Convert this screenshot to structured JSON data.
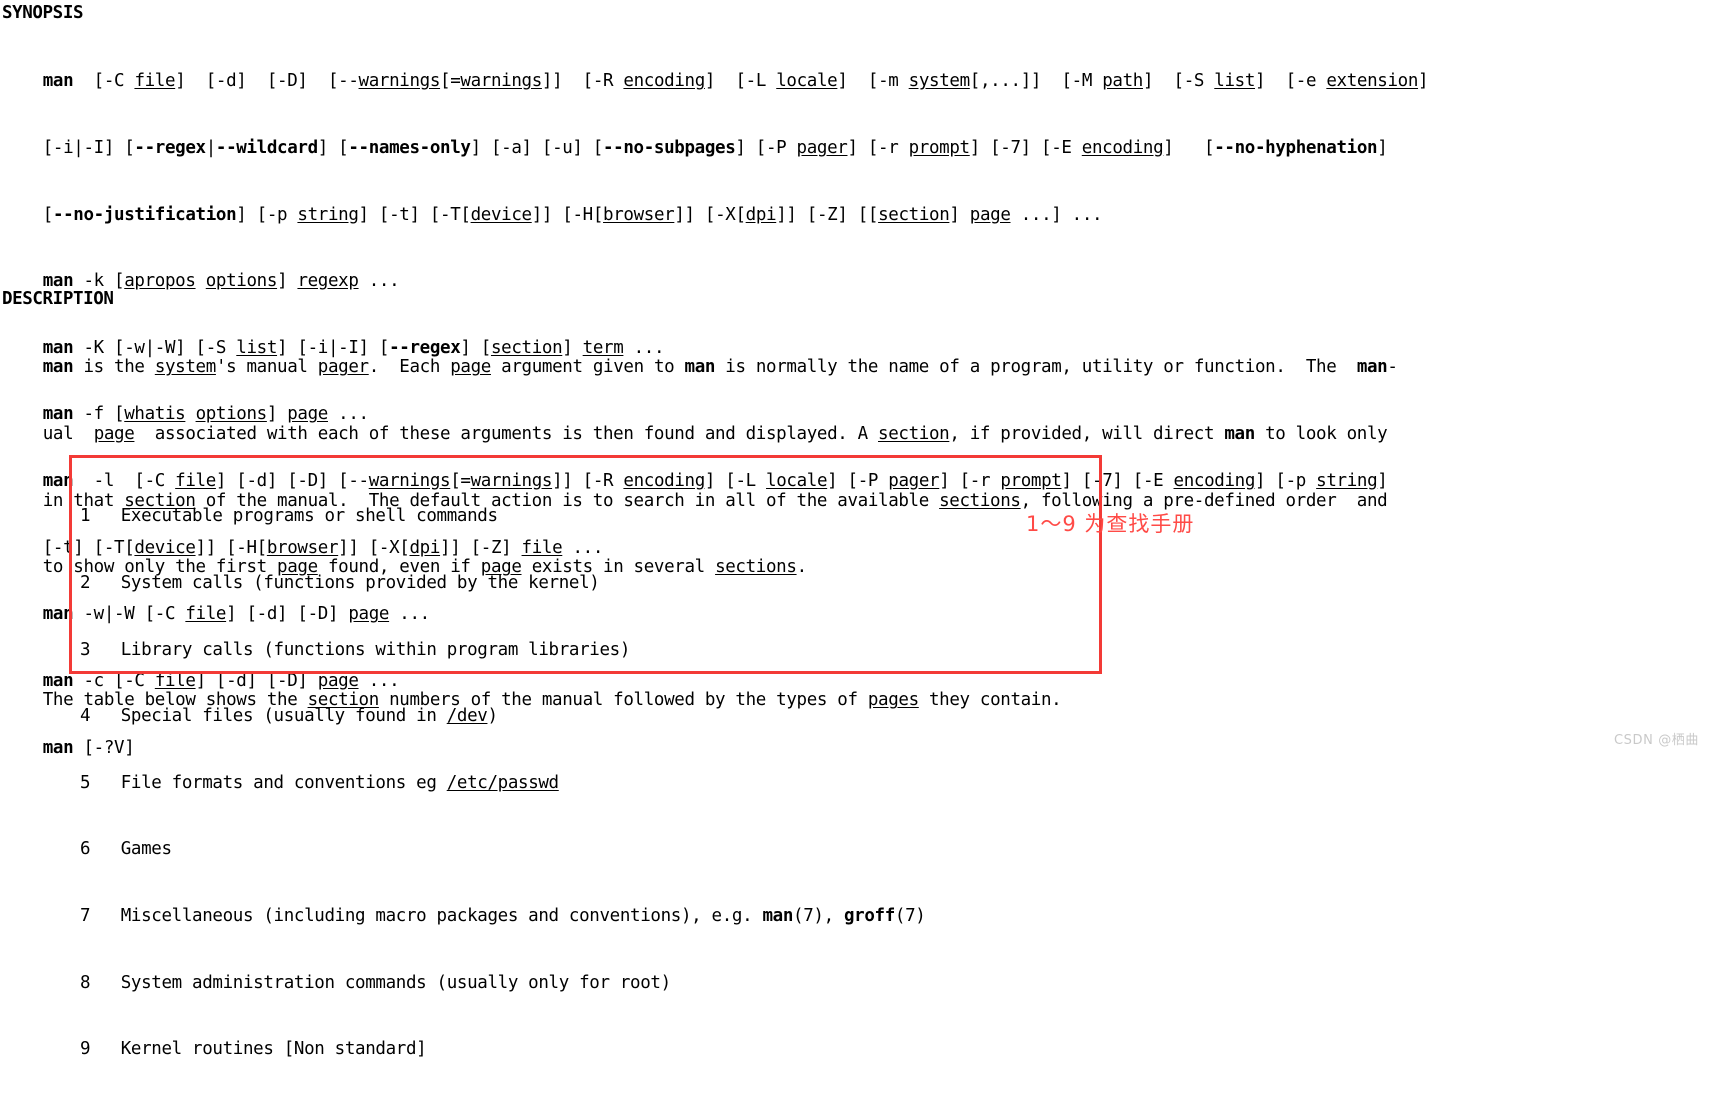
{
  "document": {
    "type": "man-page",
    "program": "man",
    "watermark": "CSDN @栖曲"
  },
  "synopsis": {
    "heading": "SYNOPSIS",
    "lines": [
      "    man  [-C file]  [-d]  [-D]  [--warnings[=warnings]]  [-R encoding]  [-L locale]  [-m system[,...]]  [-M path]  [-S list]  [-e extension]",
      "    [-i|-I] [--regex|--wildcard] [--names-only] [-a] [-u] [--no-subpages] [-P pager] [-r prompt] [-7] [-E encoding]   [--no-hyphenation]",
      "    [--no-justification] [-p string] [-t] [-T[device]] [-H[browser]] [-X[dpi]] [-Z] [[section] page ...] ...",
      "    man -k [apropos options] regexp ...",
      "    man -K [-w|-W] [-S list] [-i|-I] [--regex] [section] term ...",
      "    man -f [whatis options] page ...",
      "    man  -l  [-C file] [-d] [-D] [--warnings[=warnings]] [-R encoding] [-L locale] [-P pager] [-r prompt] [-7] [-E encoding] [-p string]",
      "    [-t] [-T[device]] [-H[browser]] [-X[dpi]] [-Z] file ...",
      "    man -w|-W [-C file] [-d] [-D] page ...",
      "    man -c [-C file] [-d] [-D] page ...",
      "    man [-?V]"
    ]
  },
  "description": {
    "heading": "DESCRIPTION",
    "paragraph1_lines": [
      "    man is the system's manual pager.  Each page argument given to man is normally the name of a program, utility or function.  The  man-",
      "    ual  page  associated with each of these arguments is then found and displayed. A section, if provided, will direct man to look only",
      "    in that section of the manual.  The default action is to search in all of the available sections, following a pre-defined order  and",
      "    to show only the first page found, even if page exists in several sections."
    ],
    "paragraph2": "    The table below shows the section numbers of the manual followed by the types of pages they contain."
  },
  "section_table": {
    "rows": [
      {
        "number": "1",
        "text": "Executable programs or shell commands"
      },
      {
        "number": "2",
        "text": "System calls (functions provided by the kernel)"
      },
      {
        "number": "3",
        "text": "Library calls (functions within program libraries)"
      },
      {
        "number": "4",
        "text": "Special files (usually found in /dev)"
      },
      {
        "number": "5",
        "text": "File formats and conventions eg /etc/passwd"
      },
      {
        "number": "6",
        "text": "Games"
      },
      {
        "number": "7",
        "text": "Miscellaneous (including macro packages and conventions), e.g. man(7), groff(7)"
      },
      {
        "number": "8",
        "text": "System administration commands (usually only for root)"
      },
      {
        "number": "9",
        "text": "Kernel routines [Non standard]"
      }
    ]
  },
  "annotation": {
    "text": "1～9 为查找手册",
    "color": "#ff4a46",
    "box_color": "#f33a36"
  }
}
